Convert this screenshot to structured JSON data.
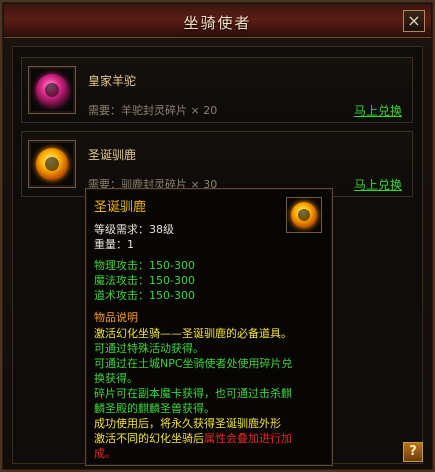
{
  "window": {
    "title": "坐骑使者",
    "close_icon": "×"
  },
  "items": [
    {
      "name": "皇家羊驼",
      "requirement": "需要：羊驼封灵碎片 × 20",
      "button": "马上兑换",
      "orb_color": "#e0288c"
    },
    {
      "name": "圣诞驯鹿",
      "requirement": "需要：驯鹿封灵碎片 × 30",
      "button": "马上兑换",
      "orb_color": "#ffb300"
    }
  ],
  "tooltip": {
    "name": "圣诞驯鹿",
    "level_req": "等级需求：38级",
    "weight": "重量：1",
    "physical_attack": "物理攻击：150-300",
    "magic_attack": "魔法攻击：150-300",
    "tao_attack": "道术攻击：150-300",
    "desc_title": "物品说明",
    "desc_1": "激活幻化坐骑——圣诞驯鹿的必备道具。",
    "desc_2": "可通过特殊活动获得。",
    "desc_3": "可通过在土城NPC坐骑使者处使用碎片兑",
    "desc_4": "换获得。",
    "desc_5": "碎片可在副本魔卡获得，也可通过击杀麒",
    "desc_6": "麟圣殿的麒麟圣兽获得。",
    "desc_7": "成功使用后，将永久获得圣诞驯鹿外形",
    "desc_8a": "激活不同的幻化坐骑后",
    "desc_8b": "属性会叠加进行加",
    "desc_9": "成。"
  },
  "help_button": "?"
}
